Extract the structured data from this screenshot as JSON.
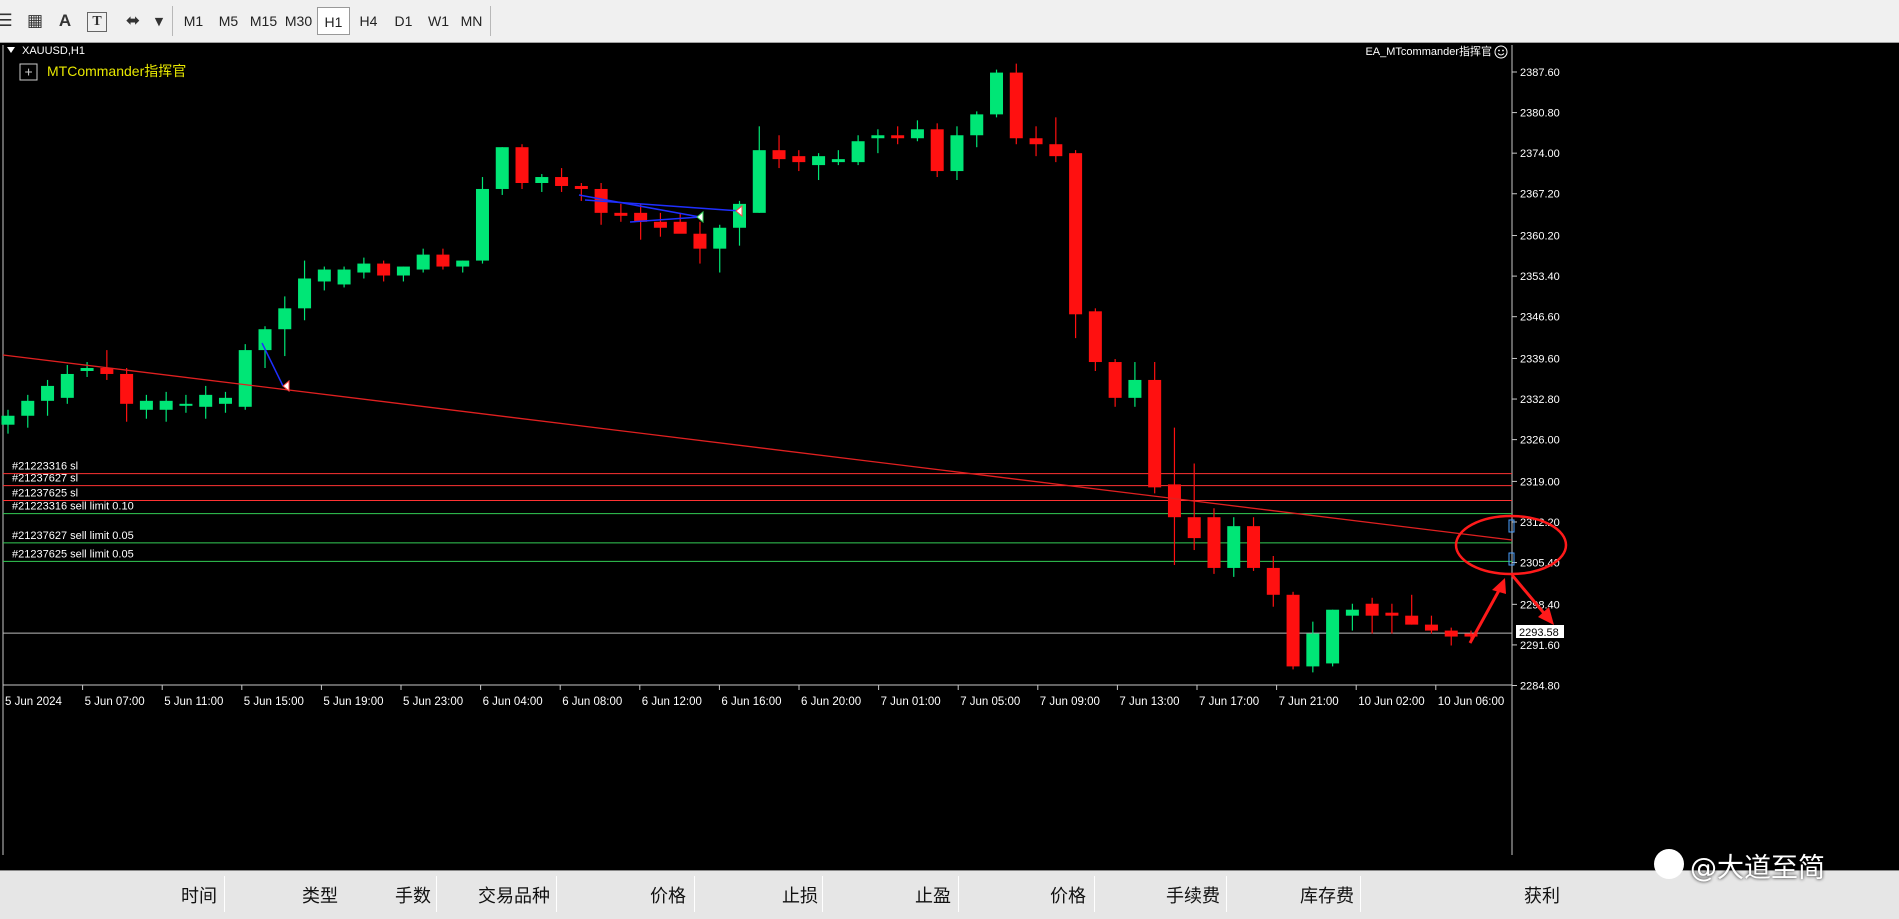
{
  "toolbar": {
    "timeframes": [
      "M1",
      "M5",
      "M15",
      "M30",
      "H1",
      "H4",
      "D1",
      "W1",
      "MN"
    ],
    "active_timeframe": "H1",
    "text_tool_label": "A",
    "text_label_tool_label": "T"
  },
  "chart": {
    "symbol_label": "XAUUSD,H1",
    "ea_label": "EA_MTcommander指挥官",
    "indicator_label": "MTCommander指挥官",
    "current_price": "2293.58",
    "price_ticks": [
      "2387.60",
      "2380.80",
      "2374.00",
      "2367.20",
      "2360.20",
      "2353.40",
      "2346.60",
      "2339.60",
      "2332.80",
      "2326.00",
      "2319.00",
      "2312.20",
      "2305.40",
      "2298.40",
      "2291.60",
      "2284.80"
    ],
    "time_ticks": [
      "5 Jun 2024",
      "5 Jun 07:00",
      "5 Jun 11:00",
      "5 Jun 15:00",
      "5 Jun 19:00",
      "5 Jun 23:00",
      "6 Jun 04:00",
      "6 Jun 08:00",
      "6 Jun 12:00",
      "6 Jun 16:00",
      "6 Jun 20:00",
      "7 Jun 01:00",
      "7 Jun 05:00",
      "7 Jun 09:00",
      "7 Jun 13:00",
      "7 Jun 17:00",
      "7 Jun 21:00",
      "10 Jun 02:00",
      "10 Jun 06:00"
    ],
    "order_lines": [
      {
        "label": "#21223316 sl",
        "price": 2320.3,
        "color": "#ff3333"
      },
      {
        "label": "#21237627 sl",
        "price": 2318.3,
        "color": "#ff3333"
      },
      {
        "label": "#21237625 sl",
        "price": 2315.8,
        "color": "#ff3333"
      },
      {
        "label": "#21223316 sell limit 0.10",
        "price": 2313.6,
        "color": "#33cc55"
      },
      {
        "label": "#21237627 sell limit 0.05",
        "price": 2308.7,
        "color": "#33cc55"
      },
      {
        "label": "#21237625 sell limit 0.05",
        "price": 2305.6,
        "color": "#33cc55"
      }
    ],
    "colors": {
      "bull": "#00e676",
      "bear": "#ff1010",
      "background": "#000000",
      "trendline": "#e02020",
      "annotation": "#ff2020"
    }
  },
  "chart_data": {
    "type": "candlestick",
    "ylim": [
      2282.0,
      2390.0
    ],
    "candles": [
      [
        2328.5,
        2331.0,
        2327.0,
        2330.0
      ],
      [
        2330.0,
        2333.5,
        2328.0,
        2332.5
      ],
      [
        2332.5,
        2336.0,
        2330.0,
        2335.0
      ],
      [
        2333.0,
        2338.5,
        2332.0,
        2337.0
      ],
      [
        2337.5,
        2339.0,
        2336.5,
        2338.0
      ],
      [
        2338.0,
        2341.0,
        2336.0,
        2337.0
      ],
      [
        2337.0,
        2338.0,
        2329.0,
        2332.0
      ],
      [
        2331.0,
        2333.5,
        2329.5,
        2332.5
      ],
      [
        2331.0,
        2334.0,
        2329.0,
        2332.5
      ],
      [
        2332.0,
        2333.5,
        2330.5,
        2332.0
      ],
      [
        2331.5,
        2335.0,
        2329.5,
        2333.5
      ],
      [
        2332.0,
        2334.0,
        2330.5,
        2333.0
      ],
      [
        2331.5,
        2342.0,
        2331.0,
        2341.0
      ],
      [
        2341.0,
        2345.0,
        2338.0,
        2344.5
      ],
      [
        2344.5,
        2350.0,
        2340.0,
        2348.0
      ],
      [
        2348.0,
        2356.0,
        2346.0,
        2353.0
      ],
      [
        2352.5,
        2355.0,
        2351.0,
        2354.5
      ],
      [
        2352.0,
        2355.0,
        2351.5,
        2354.5
      ],
      [
        2354.0,
        2356.5,
        2353.0,
        2355.5
      ],
      [
        2355.5,
        2356.0,
        2352.5,
        2353.5
      ],
      [
        2353.5,
        2355.0,
        2352.5,
        2355.0
      ],
      [
        2354.5,
        2358.0,
        2354.0,
        2357.0
      ],
      [
        2357.0,
        2358.0,
        2354.5,
        2355.0
      ],
      [
        2355.0,
        2356.0,
        2354.0,
        2356.0
      ],
      [
        2356.0,
        2370.0,
        2355.5,
        2368.0
      ],
      [
        2368.0,
        2375.0,
        2367.0,
        2375.0
      ],
      [
        2375.0,
        2375.5,
        2368.0,
        2369.0
      ],
      [
        2369.0,
        2370.5,
        2367.5,
        2370.0
      ],
      [
        2370.0,
        2371.5,
        2367.5,
        2368.5
      ],
      [
        2368.5,
        2369.0,
        2366.0,
        2368.0
      ],
      [
        2368.0,
        2369.0,
        2362.0,
        2364.0
      ],
      [
        2364.0,
        2365.5,
        2362.5,
        2363.5
      ],
      [
        2364.0,
        2365.5,
        2359.5,
        2362.5
      ],
      [
        2362.5,
        2364.0,
        2360.0,
        2361.5
      ],
      [
        2362.5,
        2364.0,
        2361.0,
        2360.5
      ],
      [
        2360.5,
        2362.5,
        2355.5,
        2358.0
      ],
      [
        2358.0,
        2362.0,
        2354.0,
        2361.5
      ],
      [
        2361.5,
        2366.0,
        2358.5,
        2365.5
      ],
      [
        2364.0,
        2378.5,
        2364.0,
        2374.5
      ],
      [
        2374.5,
        2377.0,
        2371.5,
        2373.0
      ],
      [
        2373.5,
        2374.5,
        2371.0,
        2372.5
      ],
      [
        2372.0,
        2374.0,
        2369.5,
        2373.5
      ],
      [
        2372.5,
        2374.5,
        2372.0,
        2373.0
      ],
      [
        2372.5,
        2377.0,
        2372.0,
        2376.0
      ],
      [
        2376.5,
        2378.0,
        2374.0,
        2377.0
      ],
      [
        2377.0,
        2378.5,
        2375.5,
        2376.5
      ],
      [
        2376.5,
        2379.5,
        2376.0,
        2378.0
      ],
      [
        2378.0,
        2379.0,
        2370.0,
        2371.0
      ],
      [
        2371.0,
        2378.5,
        2369.5,
        2377.0
      ],
      [
        2377.0,
        2381.0,
        2375.0,
        2380.5
      ],
      [
        2380.5,
        2388.0,
        2380.0,
        2387.5
      ],
      [
        2387.5,
        2389.0,
        2375.5,
        2376.5
      ],
      [
        2376.5,
        2378.5,
        2373.5,
        2375.5
      ],
      [
        2375.5,
        2380.0,
        2372.5,
        2373.5
      ],
      [
        2374.0,
        2374.5,
        2343.0,
        2347.0
      ],
      [
        2347.5,
        2348.0,
        2337.5,
        2339.0
      ],
      [
        2339.0,
        2339.5,
        2331.5,
        2333.0
      ],
      [
        2333.0,
        2339.0,
        2331.5,
        2336.0
      ],
      [
        2336.0,
        2339.0,
        2317.0,
        2318.0
      ],
      [
        2318.5,
        2328.0,
        2305.0,
        2313.0
      ],
      [
        2313.0,
        2322.0,
        2307.5,
        2309.5
      ],
      [
        2313.0,
        2314.5,
        2303.5,
        2304.5
      ],
      [
        2304.5,
        2313.0,
        2303.0,
        2311.5
      ],
      [
        2311.5,
        2313.0,
        2304.0,
        2304.5
      ],
      [
        2304.5,
        2306.5,
        2298.0,
        2300.0
      ],
      [
        2300.0,
        2300.5,
        2287.5,
        2288.0
      ],
      [
        2288.0,
        2295.5,
        2287.0,
        2293.5
      ],
      [
        2288.5,
        2297.5,
        2288.0,
        2297.5
      ],
      [
        2296.5,
        2298.5,
        2294.0,
        2297.5
      ],
      [
        2298.5,
        2299.5,
        2293.5,
        2296.5
      ],
      [
        2297.0,
        2298.5,
        2293.5,
        2296.5
      ],
      [
        2296.5,
        2300.0,
        2295.0,
        2295.0
      ],
      [
        2295.0,
        2296.5,
        2293.5,
        2294.0
      ],
      [
        2294.0,
        2294.5,
        2291.5,
        2293.0
      ],
      [
        2293.5,
        2294.0,
        2292.0,
        2293.0
      ]
    ]
  },
  "positions_table": {
    "columns": [
      "时间",
      "类型",
      "手数",
      "交易品种",
      "价格",
      "止损",
      "止盈",
      "价格",
      "手续费",
      "库存费",
      "获利"
    ]
  },
  "watermark": {
    "text": "@大道至简"
  }
}
